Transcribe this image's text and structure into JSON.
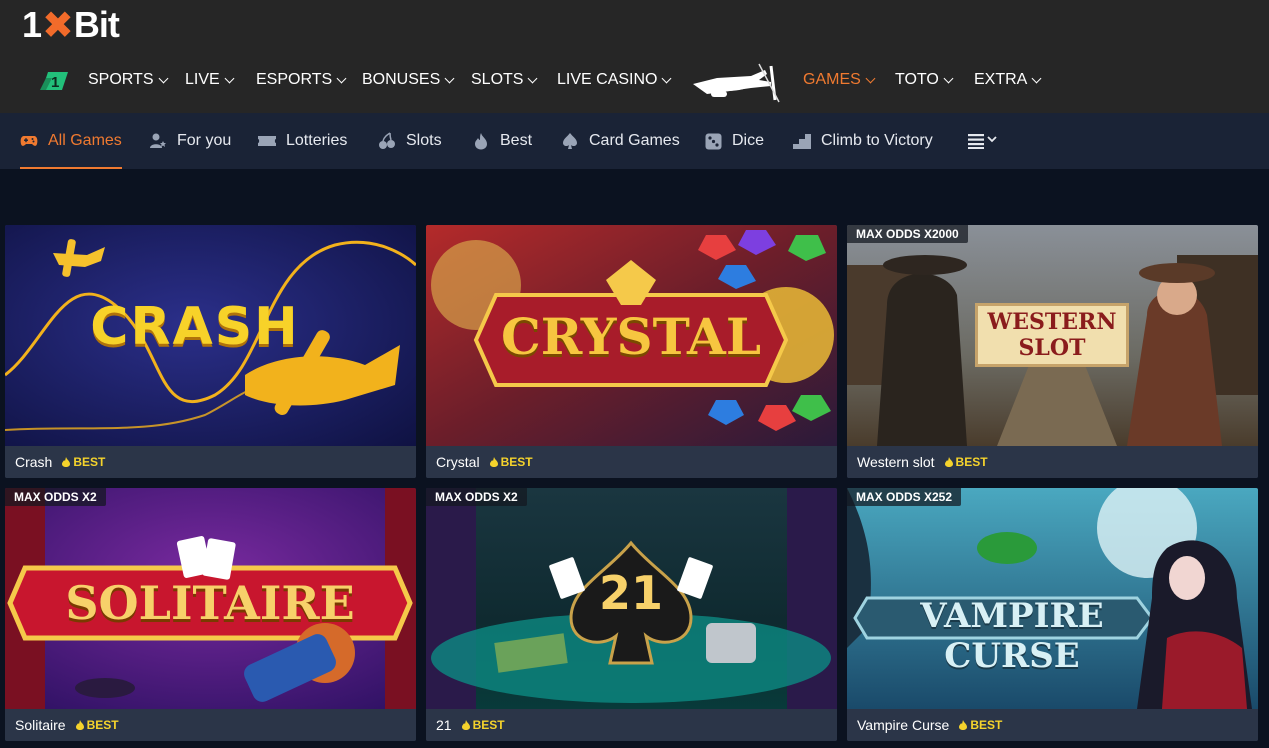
{
  "brand": {
    "logo_left": "1",
    "logo_x": "✖",
    "logo_right": "Bit",
    "accent": "#f07a30"
  },
  "nav": {
    "items": [
      {
        "label": "SPORTS"
      },
      {
        "label": "LIVE"
      },
      {
        "label": "ESPORTS"
      },
      {
        "label": "BONUSES"
      },
      {
        "label": "SLOTS"
      },
      {
        "label": "LIVE CASINO"
      },
      {
        "label": "GAMES",
        "active": true
      },
      {
        "label": "TOTO"
      },
      {
        "label": "EXTRA"
      }
    ]
  },
  "tabs": [
    {
      "label": "All Games",
      "icon": "gamepad-icon",
      "active": true
    },
    {
      "label": "For you",
      "icon": "user-star-icon"
    },
    {
      "label": "Lotteries",
      "icon": "ticket-icon"
    },
    {
      "label": "Slots",
      "icon": "cherry-icon"
    },
    {
      "label": "Best",
      "icon": "flame-icon"
    },
    {
      "label": "Card Games",
      "icon": "spade-icon"
    },
    {
      "label": "Dice",
      "icon": "dice-icon"
    },
    {
      "label": "Climb to Victory",
      "icon": "stairs-icon"
    }
  ],
  "games": [
    {
      "name": "Crash",
      "badge": "BEST",
      "odds": "",
      "art_title": "CRASH"
    },
    {
      "name": "Crystal",
      "badge": "BEST",
      "odds": "",
      "art_title": "CRYSTAL"
    },
    {
      "name": "Western slot",
      "badge": "BEST",
      "odds": "MAX ODDS X2000",
      "art_title": "WESTERN SLOT"
    },
    {
      "name": "Solitaire",
      "badge": "BEST",
      "odds": "MAX ODDS X2",
      "art_title": "SOLITAIRE"
    },
    {
      "name": "21",
      "badge": "BEST",
      "odds": "MAX ODDS X2",
      "art_title": "21"
    },
    {
      "name": "Vampire Curse",
      "badge": "BEST",
      "odds": "MAX ODDS X252",
      "art_title": "VAMPIRE CURSE"
    }
  ]
}
